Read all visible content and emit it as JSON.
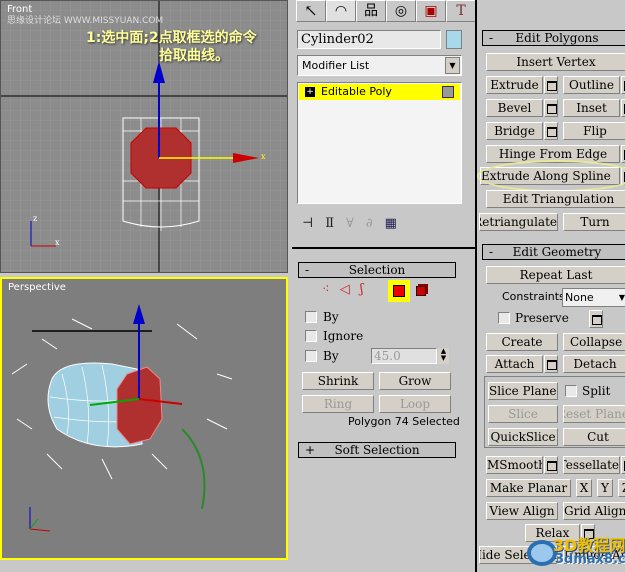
{
  "viewports": {
    "front": {
      "label": "Front",
      "annotation_line1": "1:选中面;2点取框选的命令",
      "annotation_line2": "拾取曲线。",
      "watermark": "思缘设计论坛 WWW.MISSYUAN.COM"
    },
    "perspective": {
      "label": "Perspective"
    }
  },
  "command_panel": {
    "tabs": [
      {
        "name": "create",
        "glyph": "↖"
      },
      {
        "name": "modify",
        "glyph": "◠"
      },
      {
        "name": "hierarchy",
        "glyph": "品"
      },
      {
        "name": "motion",
        "glyph": "◎"
      },
      {
        "name": "display",
        "glyph": "▣"
      },
      {
        "name": "utilities",
        "glyph": "T"
      }
    ],
    "object_name": "Cylinder02",
    "object_color": "#a8d8ec",
    "modifier_list": "Modifier List",
    "stack": [
      {
        "label": "Editable Poly",
        "expand": "+"
      }
    ],
    "stack_tools": [
      "pin-stack",
      "show-end-result",
      "make-unique",
      "remove-modifier",
      "configure-modifier-sets"
    ],
    "selection": {
      "title": "Selection",
      "collapse": "-",
      "levels": [
        "vertex",
        "edge",
        "border",
        "polygon",
        "element"
      ],
      "active_level": "polygon",
      "checkboxes": [
        {
          "label": "By",
          "checked": false
        },
        {
          "label": "Ignore",
          "checked": false
        },
        {
          "label": "By",
          "checked": false
        }
      ],
      "angle_value": "45.0",
      "buttons": {
        "shrink": "Shrink",
        "grow": "Grow",
        "ring": "Ring",
        "loop": "Loop"
      },
      "status": "Polygon 74 Selected"
    },
    "soft_selection": {
      "title": "Soft Selection",
      "expand": "+"
    }
  },
  "edit_polygons": {
    "title": "Edit Polygons",
    "collapse": "-",
    "insert_vertex": "Insert Vertex",
    "extrude": "Extrude",
    "outline": "Outline",
    "bevel": "Bevel",
    "inset": "Inset",
    "bridge": "Bridge",
    "flip": "Flip",
    "hinge": "Hinge From Edge",
    "extrude_spline": "Extrude Along Spline",
    "edit_tri": "Edit Triangulation",
    "retriangulate": "Retriangulate",
    "turn": "Turn"
  },
  "edit_geometry": {
    "title": "Edit Geometry",
    "collapse": "-",
    "repeat_last": "Repeat Last",
    "constraints_label": "Constraints:",
    "constraints_value": "None",
    "preserve": "Preserve",
    "create": "Create",
    "collapse_btn": "Collapse",
    "attach": "Attach",
    "detach": "Detach",
    "slice_plane": "Slice Plane",
    "split": "Split",
    "slice": "Slice",
    "reset_plane": "Reset Plane",
    "quickslice": "QuickSlice",
    "cut": "Cut",
    "msmooth": "MSmooth",
    "tessellate": "Tessellate",
    "make_planar": "Make Planar",
    "x": "X",
    "y": "Y",
    "z": "Z",
    "view_align": "View Align",
    "grid_align": "Grid Align",
    "relax": "Relax",
    "hide_selected": "Hide Selected",
    "unhide_all": "Unhide All"
  },
  "watermark": {
    "line1": "3D教程网",
    "line2": "3dmax8.cn"
  }
}
